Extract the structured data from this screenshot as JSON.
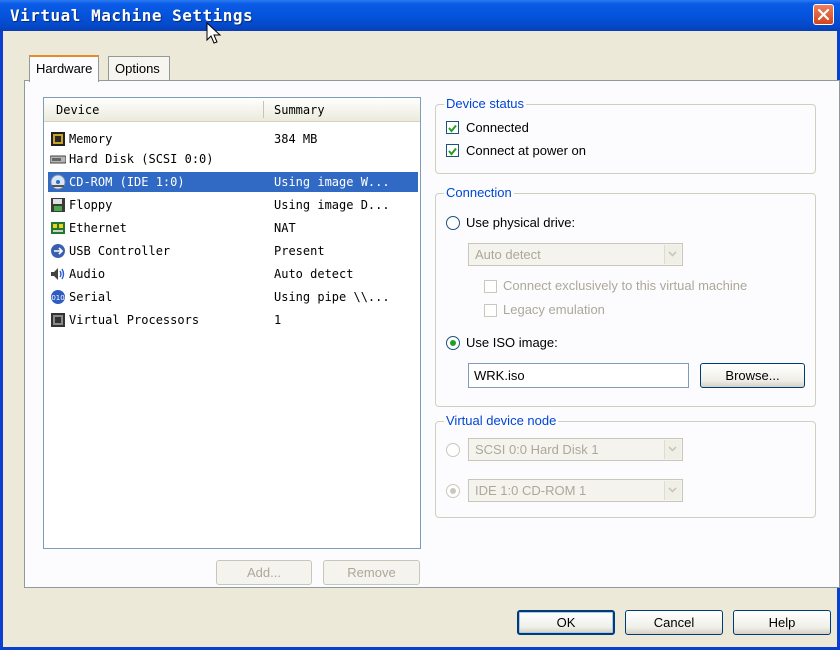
{
  "window": {
    "title": "Virtual Machine Settings"
  },
  "tabs": [
    {
      "label": "Hardware",
      "active": true
    },
    {
      "label": "Options",
      "active": false
    }
  ],
  "device_list": {
    "columns": [
      "Device",
      "Summary"
    ],
    "rows": [
      {
        "name": "Memory",
        "summary": "384 MB",
        "icon": "memory-icon",
        "selected": false
      },
      {
        "name": "Hard Disk (SCSI 0:0)",
        "summary": "",
        "icon": "hard-disk-icon",
        "selected": false
      },
      {
        "name": "CD-ROM (IDE 1:0)",
        "summary": "Using image W...",
        "icon": "cd-rom-icon",
        "selected": true
      },
      {
        "name": "Floppy",
        "summary": "Using image D...",
        "icon": "floppy-icon",
        "selected": false
      },
      {
        "name": "Ethernet",
        "summary": "NAT",
        "icon": "ethernet-icon",
        "selected": false
      },
      {
        "name": "USB Controller",
        "summary": "Present",
        "icon": "usb-icon",
        "selected": false
      },
      {
        "name": "Audio",
        "summary": "Auto detect",
        "icon": "audio-icon",
        "selected": false
      },
      {
        "name": "Serial",
        "summary": "Using pipe \\\\...",
        "icon": "serial-icon",
        "selected": false
      },
      {
        "name": "Virtual Processors",
        "summary": "1",
        "icon": "processor-icon",
        "selected": false
      }
    ]
  },
  "list_buttons": {
    "add": "Add...",
    "remove": "Remove"
  },
  "device_status": {
    "title": "Device status",
    "connected": "Connected",
    "connect_at_power_on": "Connect at power on"
  },
  "connection": {
    "title": "Connection",
    "use_physical_drive": "Use physical drive:",
    "drive_select_value": "Auto detect",
    "connect_exclusively": "Connect exclusively to this virtual machine",
    "legacy_emulation": "Legacy emulation",
    "use_iso_image": "Use ISO image:",
    "iso_value": "WRK.iso",
    "browse": "Browse..."
  },
  "virtual_device_node": {
    "title": "Virtual device node",
    "scsi_value": "SCSI 0:0  Hard Disk 1",
    "ide_value": "IDE 1:0  CD-ROM 1"
  },
  "footer": {
    "ok": "OK",
    "cancel": "Cancel",
    "help": "Help"
  },
  "colors": {
    "title_bar": "#0553dc",
    "selection": "#316ac5",
    "group_title": "#0046d5",
    "window_bg": "#ece9d8"
  }
}
